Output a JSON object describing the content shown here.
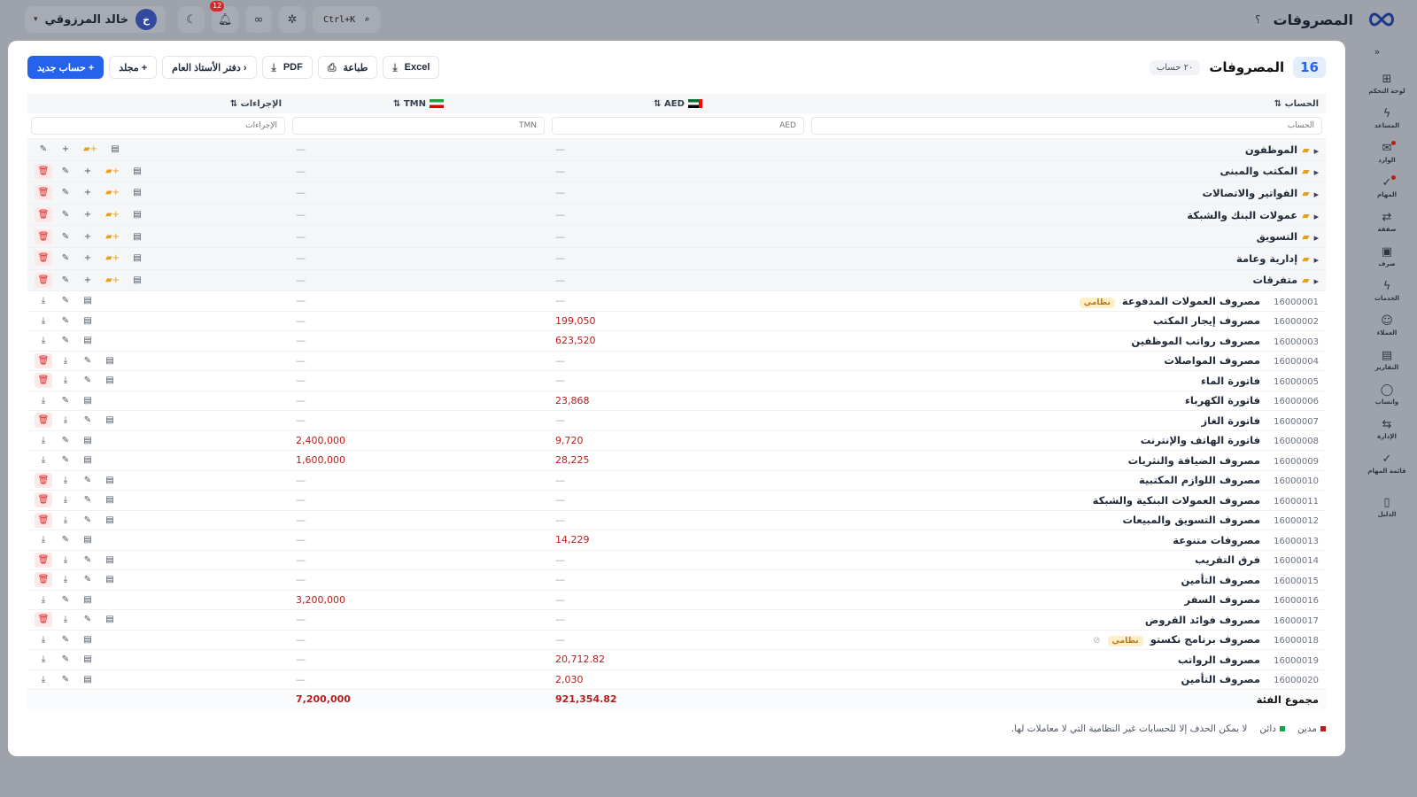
{
  "topbar": {
    "title": "المصروفات",
    "help": "؟",
    "search_shortcut": "Ctrl+K",
    "notifications_count": "12",
    "user_name": "خالد المرزوقي",
    "user_initial": "خ"
  },
  "sidebar": {
    "items": [
      {
        "label": "لوحة التحكم",
        "icon": "⊞"
      },
      {
        "label": "المساعد",
        "icon": "ϟ"
      },
      {
        "label": "الوارد",
        "icon": "✉"
      },
      {
        "label": "المهام",
        "icon": "✓"
      },
      {
        "label": "صفقة",
        "icon": "⇄"
      },
      {
        "label": "صرف",
        "icon": "▣"
      },
      {
        "label": "الخدمات",
        "icon": "ϟ"
      },
      {
        "label": "العملاء",
        "icon": "☺"
      },
      {
        "label": "التقارير",
        "icon": "▤"
      },
      {
        "label": "واتساب",
        "icon": "◯"
      },
      {
        "label": "الإدارة",
        "icon": "⇆"
      },
      {
        "label": "قائمة المهام",
        "icon": "✓"
      },
      {
        "label": "الدليل",
        "icon": "▯"
      }
    ]
  },
  "panel": {
    "count": "16",
    "title": "المصروفات",
    "accounts_badge": "٢٠ حساب",
    "buttons": {
      "new_account": "+ حساب جديد",
      "folder": "+ مجلد",
      "ledger": "‹ دفتر الأستاذ العام",
      "pdf": "PDF",
      "print": "طباعة",
      "excel": "Excel"
    }
  },
  "table": {
    "headers": {
      "account": "الحساب ⇅",
      "aed": "AED ⇅",
      "tmn": "TMN ⇅",
      "actions": "الإجراءات ⇅"
    },
    "filters": {
      "account": "الحساب",
      "aed": "AED",
      "tmn": "TMN",
      "actions": "الإجراءات"
    },
    "groups": [
      {
        "name": "الموظفون",
        "aed": "—",
        "tmn": "—"
      },
      {
        "name": "المكتب والمبنى",
        "aed": "—",
        "tmn": "—"
      },
      {
        "name": "الفواتير والاتصالات",
        "aed": "—",
        "tmn": "—"
      },
      {
        "name": "عمولات البنك والشبكة",
        "aed": "—",
        "tmn": "—"
      },
      {
        "name": "التسويق",
        "aed": "—",
        "tmn": "—"
      },
      {
        "name": "إدارية وعامة",
        "aed": "—",
        "tmn": "—"
      },
      {
        "name": "متفرقات",
        "aed": "—",
        "tmn": "—"
      }
    ],
    "accounts": [
      {
        "code": "16000001",
        "name": "مصروف العمولات المدفوعة",
        "system": "نظامي",
        "aed": "—",
        "tmn": "—"
      },
      {
        "code": "16000002",
        "name": "مصروف إيجار المكتب",
        "aed": "199,050",
        "tmn": "—"
      },
      {
        "code": "16000003",
        "name": "مصروف رواتب الموظفين",
        "aed": "623,520",
        "tmn": "—"
      },
      {
        "code": "16000004",
        "name": "مصروف المواصلات",
        "aed": "—",
        "tmn": "—",
        "deletable": true
      },
      {
        "code": "16000005",
        "name": "فاتورة الماء",
        "aed": "—",
        "tmn": "—",
        "deletable": true
      },
      {
        "code": "16000006",
        "name": "فاتورة الكهرباء",
        "aed": "23,868",
        "tmn": "—"
      },
      {
        "code": "16000007",
        "name": "فاتورة الغاز",
        "aed": "—",
        "tmn": "—",
        "deletable": true
      },
      {
        "code": "16000008",
        "name": "فاتورة الهاتف والإنترنت",
        "aed": "9,720",
        "tmn": "2,400,000"
      },
      {
        "code": "16000009",
        "name": "مصروف الضيافة والنثريات",
        "aed": "28,225",
        "tmn": "1,600,000"
      },
      {
        "code": "16000010",
        "name": "مصروف اللوازم المكتبية",
        "aed": "—",
        "tmn": "—",
        "deletable": true
      },
      {
        "code": "16000011",
        "name": "مصروف العمولات البنكية والشبكة",
        "aed": "—",
        "tmn": "—",
        "deletable": true
      },
      {
        "code": "16000012",
        "name": "مصروف التسويق والمبيعات",
        "aed": "—",
        "tmn": "—",
        "deletable": true
      },
      {
        "code": "16000013",
        "name": "مصروفات متنوعة",
        "aed": "14,229",
        "tmn": "—"
      },
      {
        "code": "16000014",
        "name": "فرق التقريب",
        "aed": "—",
        "tmn": "—",
        "deletable": true
      },
      {
        "code": "16000015",
        "name": "مصروف التأمين",
        "aed": "—",
        "tmn": "—",
        "deletable": true
      },
      {
        "code": "16000016",
        "name": "مصروف السفر",
        "aed": "—",
        "tmn": "3,200,000"
      },
      {
        "code": "16000017",
        "name": "مصروف فوائد القروض",
        "aed": "—",
        "tmn": "—",
        "deletable": true
      },
      {
        "code": "16000018",
        "name": "مصروف برنامج نكستو",
        "system": "نظامي",
        "hidden_icon": true,
        "aed": "—",
        "tmn": "—"
      },
      {
        "code": "16000019",
        "name": "مصروف الرواتب",
        "aed": "20,712.82",
        "tmn": "—"
      },
      {
        "code": "16000020",
        "name": "مصروف التأمين",
        "aed": "2,030",
        "tmn": "—"
      }
    ],
    "total": {
      "label": "مجموع الفئة",
      "aed": "921,354.82",
      "tmn": "7,200,000"
    }
  },
  "legend": {
    "debit": "مدين",
    "credit": "دائن",
    "note": "لا يمكن الحذف إلا للحسابات غير النظامية التي لا معاملات لها."
  },
  "colors": {
    "primary": "#2563eb",
    "debit": "#b91c1c",
    "credit": "#16a34a",
    "folder": "#e4a11b"
  }
}
